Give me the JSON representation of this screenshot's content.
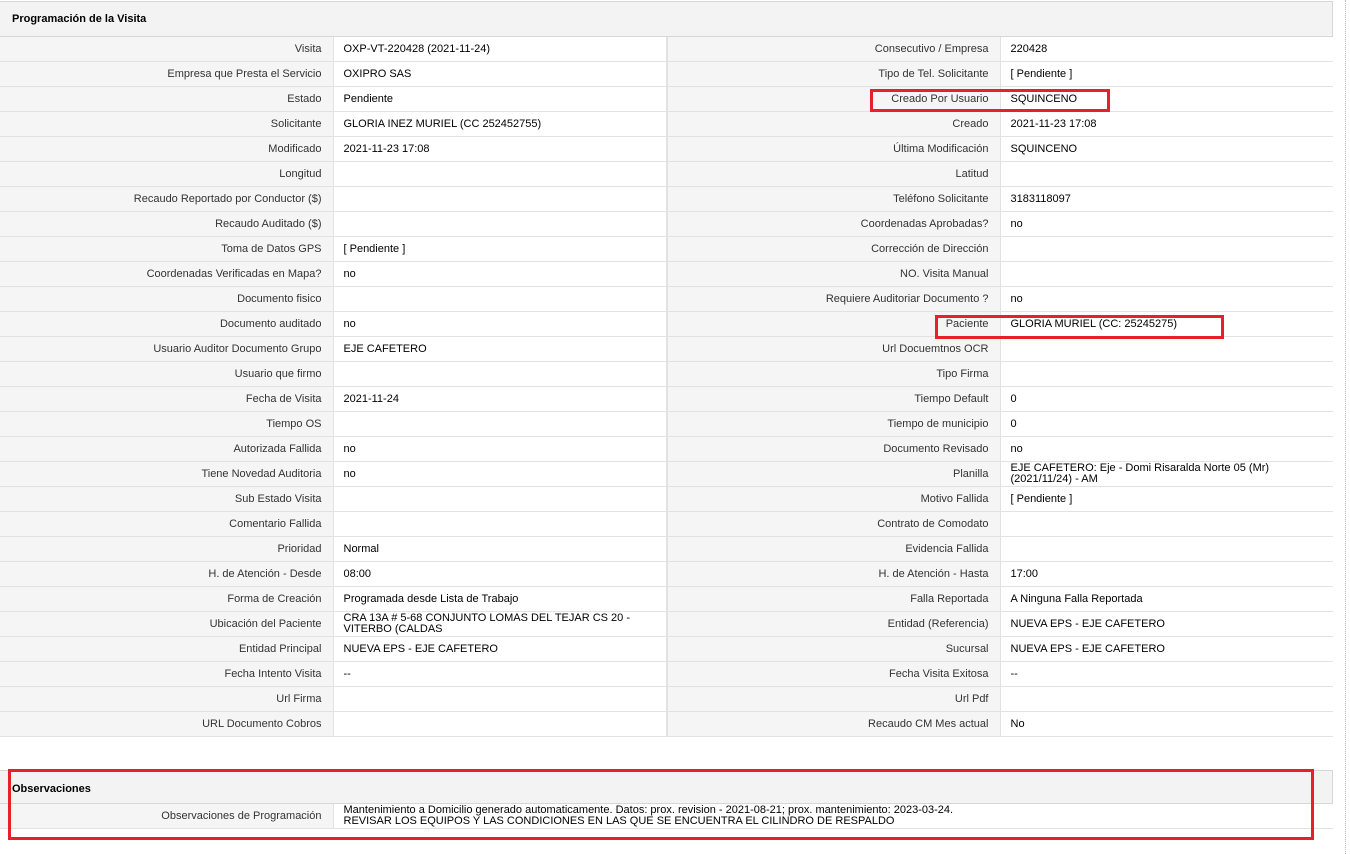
{
  "section": {
    "title": "Programación de la Visita"
  },
  "rows": [
    {
      "l1": "Visita",
      "v1": "OXP-VT-220428 (2021-11-24)",
      "l2": "Consecutivo / Empresa",
      "v2": "220428"
    },
    {
      "l1": "Empresa que Presta el Servicio",
      "v1": "OXIPRO SAS",
      "l2": "Tipo de Tel. Solicitante",
      "v2": "[ Pendiente ]"
    },
    {
      "l1": "Estado",
      "v1": "Pendiente",
      "l2": "Creado Por Usuario",
      "v2": "SQUINCENO"
    },
    {
      "l1": "Solicitante",
      "v1": "GLORIA INEZ MURIEL (CC 252452755)",
      "l2": "Creado",
      "v2": "2021-11-23 17:08"
    },
    {
      "l1": "Modificado",
      "v1": "2021-11-23 17:08",
      "l2": "Última Modificación",
      "v2": " SQUINCENO"
    },
    {
      "l1": "Longitud",
      "v1": "",
      "l2": "Latitud",
      "v2": ""
    },
    {
      "l1": "Recaudo Reportado por Conductor ($)",
      "v1": "",
      "l2": "Teléfono Solicitante",
      "v2": "3183118097"
    },
    {
      "l1": "Recaudo Auditado ($)",
      "v1": "",
      "l2": "Coordenadas Aprobadas?",
      "v2": " no"
    },
    {
      "l1": "Toma de Datos GPS",
      "v1": "[ Pendiente ]",
      "l2": "Corrección de Dirección",
      "v2": ""
    },
    {
      "l1": "Coordenadas Verificadas en Mapa?",
      "v1": " no",
      "l2": "NO. Visita Manual",
      "v2": ""
    },
    {
      "l1": "Documento fisico",
      "v1": "",
      "l2": "Requiere Auditoriar Documento ?",
      "v2": " no"
    },
    {
      "l1": "Documento auditado",
      "v1": " no",
      "l2": "Paciente",
      "v2": "GLORIA MURIEL (CC: 25245275)"
    },
    {
      "l1": "Usuario Auditor Documento Grupo",
      "v1": "EJE CAFETERO",
      "l2": "Url Docuemtnos OCR",
      "v2": ""
    },
    {
      "l1": "Usuario que firmo",
      "v1": "",
      "l2": "Tipo Firma",
      "v2": ""
    },
    {
      "l1": "Fecha de Visita",
      "v1": " 2021-11-24",
      "l2": "Tiempo Default",
      "v2": "0"
    },
    {
      "l1": "Tiempo OS",
      "v1": "",
      "l2": "Tiempo de municipio",
      "v2": "0"
    },
    {
      "l1": "Autorizada Fallida",
      "v1": " no",
      "l2": "Documento Revisado",
      "v2": " no"
    },
    {
      "l1": "Tiene Novedad Auditoria",
      "v1": " no",
      "l2": "Planilla",
      "v2": "EJE CAFETERO: Eje - Domi Risaralda Norte 05 (Mr) (2021/11/24) - AM"
    },
    {
      "l1": "Sub Estado Visita",
      "v1": "",
      "l2": "Motivo Fallida",
      "v2": "[ Pendiente ]"
    },
    {
      "l1": "Comentario Fallida",
      "v1": "",
      "l2": "Contrato de Comodato",
      "v2": ""
    },
    {
      "l1": "Prioridad",
      "v1": "Normal",
      "l2": "Evidencia Fallida",
      "v2": ""
    },
    {
      "l1": "H. de Atención - Desde",
      "v1": "08:00",
      "l2": "H. de Atención - Hasta",
      "v2": "17:00"
    },
    {
      "l1": "Forma de Creación",
      "v1": "Programada desde Lista de Trabajo",
      "l2": "Falla Reportada",
      "v2": "A Ninguna Falla Reportada"
    },
    {
      "l1": "Ubicación del Paciente",
      "v1": "CRA 13A # 5-68 CONJUNTO LOMAS DEL TEJAR CS 20 - VITERBO (CALDAS",
      "l2": "Entidad (Referencia)",
      "v2": "NUEVA EPS - EJE CAFETERO"
    },
    {
      "l1": "Entidad Principal",
      "v1": "NUEVA EPS - EJE CAFETERO",
      "l2": "Sucursal",
      "v2": "NUEVA EPS - EJE CAFETERO"
    },
    {
      "l1": "Fecha Intento Visita",
      "v1": " --",
      "l2": "Fecha Visita Exitosa",
      "v2": " --"
    },
    {
      "l1": "Url Firma",
      "v1": "",
      "l2": "Url Pdf",
      "v2": ""
    },
    {
      "l1": "URL Documento Cobros",
      "v1": "",
      "l2": "Recaudo CM Mes actual",
      "v2": "No"
    }
  ],
  "observaciones": {
    "title": "Observaciones",
    "label": "Observaciones de Programación",
    "line1": "Mantenimiento a Domicilio generado automaticamente. Datos: prox. revision - 2021-08-21; prox. mantenimiento: 2023-03-24.",
    "line2": "REVISAR LOS EQUIPOS Y LAS CONDICIONES EN LAS QUE SE ENCUENTRA EL CILINDRO DE RESPALDO"
  },
  "highlight_color": "#e8202a"
}
